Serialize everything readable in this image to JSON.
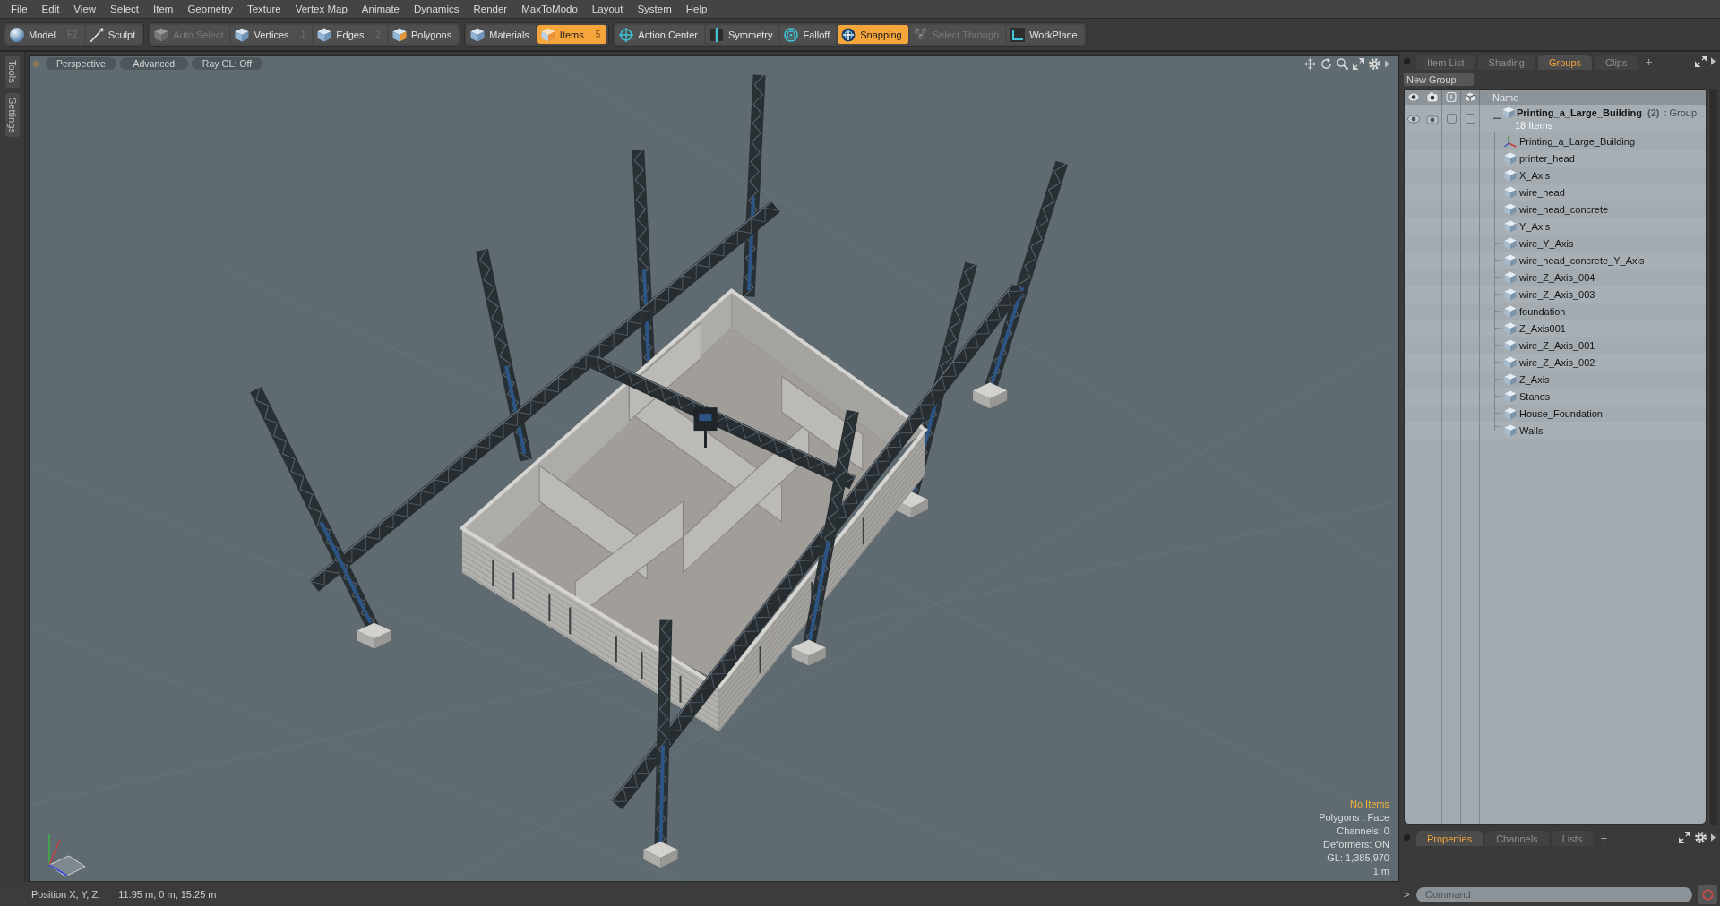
{
  "menu_bar": {
    "items": [
      "File",
      "Edit",
      "View",
      "Select",
      "Item",
      "Geometry",
      "Texture",
      "Vertex Map",
      "Animate",
      "Dynamics",
      "Render",
      "MaxToModo",
      "Layout",
      "System",
      "Help"
    ]
  },
  "toolbar": {
    "groups": [
      {
        "items": [
          {
            "label": "Model",
            "hint": "F2",
            "kind": "model",
            "selected": false,
            "disabled": false
          },
          {
            "label": "Sculpt",
            "kind": "sculpt",
            "selected": false,
            "disabled": false
          }
        ]
      },
      {
        "items": [
          {
            "label": "Auto Select",
            "kind": "autoselect",
            "selected": false,
            "disabled": true
          },
          {
            "label": "Vertices",
            "hint": "1",
            "kind": "vertices",
            "selected": false,
            "disabled": false
          },
          {
            "label": "Edges",
            "hint": "2",
            "kind": "edges",
            "selected": false,
            "disabled": false
          },
          {
            "label": "Polygons",
            "kind": "polygons",
            "selected": false,
            "disabled": false
          }
        ]
      },
      {
        "items": [
          {
            "label": "Materials",
            "kind": "materials",
            "selected": false,
            "disabled": false
          },
          {
            "label": "Items",
            "hint": "5",
            "kind": "items",
            "selected": true,
            "disabled": false
          }
        ]
      },
      {
        "items": [
          {
            "label": "Action Center",
            "kind": "center",
            "selected": false,
            "disabled": false
          },
          {
            "label": "Symmetry",
            "kind": "symmetry",
            "selected": false,
            "disabled": false
          },
          {
            "label": "Falloff",
            "kind": "falloff",
            "selected": false,
            "disabled": false
          },
          {
            "label": "Snapping",
            "kind": "snapping",
            "selected": true,
            "disabled": false
          },
          {
            "label": "Select Through",
            "kind": "through",
            "selected": false,
            "disabled": true
          },
          {
            "label": "WorkPlane",
            "kind": "workplane",
            "selected": false,
            "disabled": false
          }
        ]
      }
    ]
  },
  "side_tabs": [
    "Tools",
    "Settings"
  ],
  "viewport": {
    "view_buttons": [
      "Perspective",
      "Advanced",
      "Ray GL: Off"
    ],
    "selection_status": "No Items",
    "stats": [
      "Polygons : Face",
      "Channels: 0",
      "Deformers: ON",
      "GL: 1,385,970",
      "1 m"
    ]
  },
  "groups_panel": {
    "tabs": [
      {
        "label": "Item List",
        "selected": false
      },
      {
        "label": "Shading",
        "selected": false
      },
      {
        "label": "Groups",
        "selected": true
      },
      {
        "label": "Clips",
        "selected": false
      }
    ],
    "add_tab": "+",
    "new_group_button": "New Group",
    "name_column": "Name",
    "tree": [
      {
        "name": "Printing_a_Large_Building",
        "count": "(2)",
        "type_label": ": Group",
        "subtitle": "18 Items",
        "expanded": true,
        "visible": true,
        "renderable": true,
        "locked": false,
        "column_4_checked": false,
        "children": [
          {
            "name": "Printing_a_Large_Building",
            "kind": "locator"
          },
          {
            "name": "printer_head",
            "kind": "mesh"
          },
          {
            "name": "X_Axis",
            "kind": "mesh"
          },
          {
            "name": "wire_head",
            "kind": "mesh"
          },
          {
            "name": "wire_head_concrete",
            "kind": "mesh"
          },
          {
            "name": "Y_Axis",
            "kind": "mesh"
          },
          {
            "name": "wire_Y_Axis",
            "kind": "mesh"
          },
          {
            "name": "wire_head_concrete_Y_Axis",
            "kind": "mesh"
          },
          {
            "name": "wire_Z_Axis_004",
            "kind": "mesh"
          },
          {
            "name": "wire_Z_Axis_003",
            "kind": "mesh"
          },
          {
            "name": "foundation",
            "kind": "mesh"
          },
          {
            "name": "Z_Axis001",
            "kind": "mesh"
          },
          {
            "name": "wire_Z_Axis_001",
            "kind": "mesh"
          },
          {
            "name": "wire_Z_Axis_002",
            "kind": "mesh"
          },
          {
            "name": "Z_Axis",
            "kind": "mesh"
          },
          {
            "name": "Stands",
            "kind": "mesh"
          },
          {
            "name": "House_Foundation",
            "kind": "mesh"
          },
          {
            "name": "Walls",
            "kind": "mesh"
          }
        ]
      }
    ]
  },
  "bottom_panel": {
    "tabs": [
      {
        "label": "Properties",
        "selected": true
      },
      {
        "label": "Channels",
        "selected": false
      },
      {
        "label": "Lists",
        "selected": false
      }
    ],
    "add_tab": "+",
    "command": {
      "prompt": ">",
      "placeholder": "Command"
    }
  },
  "status_bar": {
    "label": "Position X, Y, Z:",
    "value": "11.95 m, 0 m, 15.25 m"
  }
}
